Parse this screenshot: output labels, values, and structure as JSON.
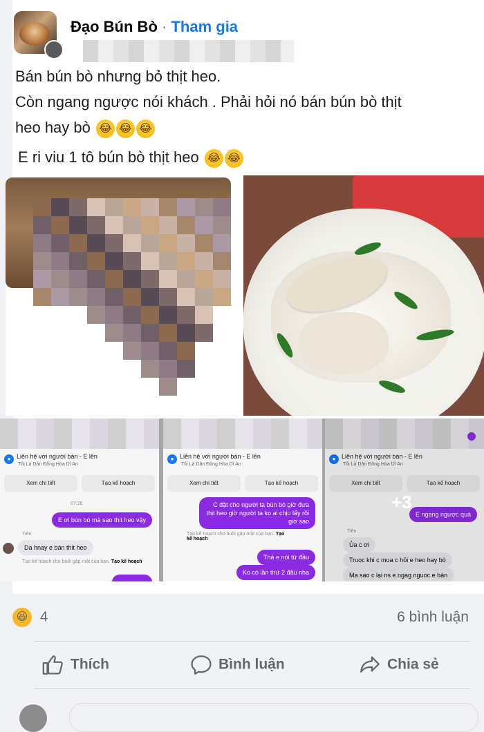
{
  "post": {
    "group_name": "Đạo Bún Bò",
    "separator": "·",
    "join_label": "Tham gia",
    "text_lines": [
      "Bán bún bò nhưng bỏ thịt heo.",
      "Còn ngang ngược nói khách . Phải hỏi nó bán bún bò thịt",
      "heo hay bò"
    ],
    "text_extra": "E ri viu 1 tô bún bò thịt heo"
  },
  "screenshots": [
    {
      "seller_title": "Liên hệ với người bán - E lên",
      "seller_sub": "Tôi Là Dân Đông Hòa Dĩ An",
      "btn_detail": "Xem chi tiết",
      "btn_plan": "Tạo kế hoạch",
      "time": "07:26",
      "msg_out_1": "E ơi bún bò mà sao thịt heo vậy",
      "sender": "Tiên",
      "msg_in_1": "Da hnay e bán thit heo",
      "plan_hint": "Tạo kế hoạch cho buổi gặp mặt của bạn.",
      "plan_link": "Tạo kế hoạch"
    },
    {
      "seller_title": "Liên hệ với người bán - E lên",
      "seller_sub": "Tôi Là Dân Đông Hòa Dĩ An",
      "btn_detail": "Xem chi tiết",
      "btn_plan": "Tạo kế hoạch",
      "msg_out_1": "C đặt cho người ta bún bò giờ đưa thịt heo giờ người ta ko ai chịu lấy rồi giờ sao",
      "plan_hint": "Tạo kế hoạch cho buổi gặp mặt của bạn.",
      "plan_link": "Tạo kế hoạch",
      "msg_out_2": "Thả e nói từ đầu",
      "msg_out_3": "Ko có lần thứ 2 đâu nha"
    },
    {
      "seller_title": "Liên hệ với người bán - E lên",
      "seller_sub": "Tôi Là Dân Đông Hòa Dĩ An",
      "btn_detail": "Xem chi tiết",
      "btn_plan": "Tạo kế hoạch",
      "msg_out_1": "E ngang ngược quá",
      "sender": "Tiên",
      "msg_in_1": "Ủa c ơi",
      "msg_in_2": "Truoc khi c mua c hỏi e heo hay bò",
      "msg_in_3": "Ma sao c lại ns e ngag nguoc e bán"
    }
  ],
  "more_images": "+3",
  "footer": {
    "reaction_count": "4",
    "comment_count": "6 bình luận",
    "like_label": "Thích",
    "comment_label": "Bình luận",
    "share_label": "Chia sẻ"
  },
  "colors": {
    "accent": "#1877f2",
    "messenger_bubble": "#8a2be2",
    "muted_text": "#65676b"
  },
  "icons": [
    "laugh-emoji-icon",
    "like-icon",
    "comment-icon",
    "share-icon",
    "group-icon"
  ]
}
